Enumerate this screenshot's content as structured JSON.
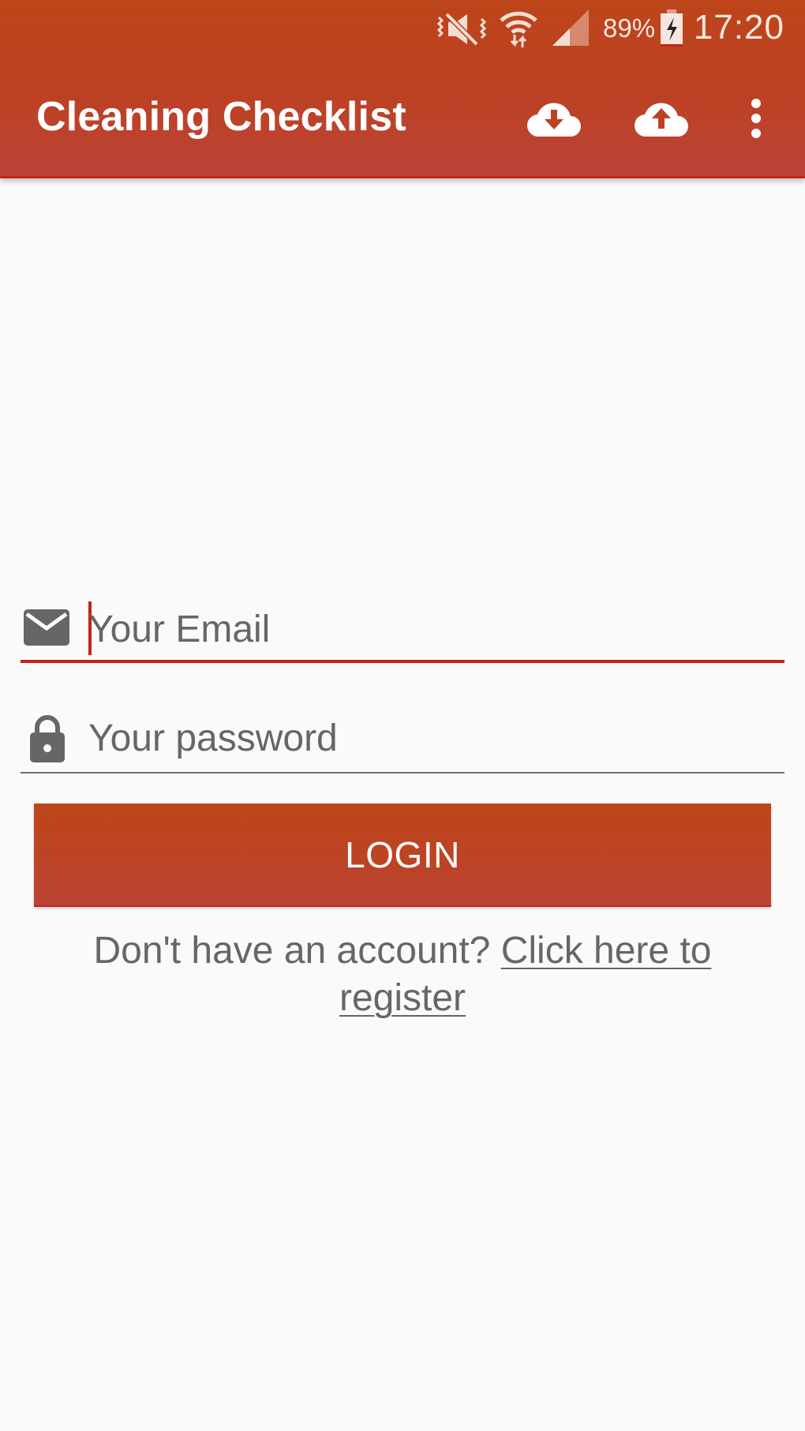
{
  "status_bar": {
    "icons": [
      "vibrate-mute-icon",
      "wifi-icon",
      "signal-icon",
      "battery-charging-icon"
    ],
    "battery_percent": "89%",
    "time": "17:20"
  },
  "app_bar": {
    "title": "Cleaning Checklist",
    "actions": [
      {
        "name": "cloud-download",
        "icon": "cloud-download-icon"
      },
      {
        "name": "cloud-upload",
        "icon": "cloud-upload-icon"
      },
      {
        "name": "overflow-menu",
        "icon": "more-vert-icon"
      }
    ],
    "colors": {
      "primary": "#bc4124",
      "accent": "#c4231a"
    }
  },
  "login_form": {
    "email": {
      "value": "",
      "placeholder": "Your Email",
      "icon": "email-icon",
      "focused": true
    },
    "password": {
      "value": "",
      "placeholder": "Your password",
      "icon": "lock-icon"
    },
    "login_button_label": "LOGIN",
    "register_prompt": "Don't have an account? ",
    "register_link_label": "Click here to register"
  }
}
